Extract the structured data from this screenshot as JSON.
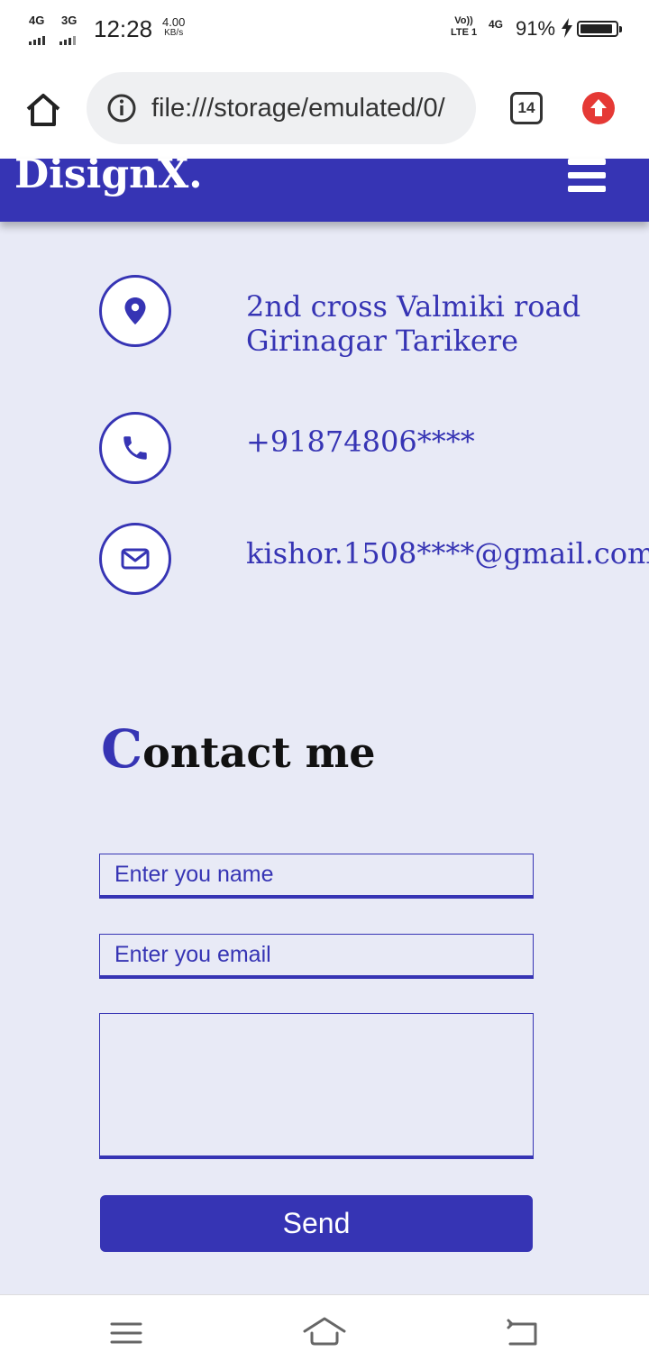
{
  "status_bar": {
    "net1": "4G",
    "net2": "3G",
    "time": "12:28",
    "speed_value": "4.00",
    "speed_unit": "KB/s",
    "volte_top": "Vo))",
    "volte_bottom": "LTE 1",
    "net3": "4G",
    "battery_percent": "91%",
    "battery_level": 0.91
  },
  "browser": {
    "url": "file:///storage/emulated/0/",
    "tab_count": "14",
    "icons": [
      "home-icon",
      "info-icon",
      "tabs-icon",
      "update-icon"
    ]
  },
  "site": {
    "logo": "DisignX.",
    "menu_icon": "hamburger-menu-icon",
    "accent_color": "#3634b4",
    "background_color": "#e8eaf6"
  },
  "contact_info": {
    "address_line1": "2nd cross Valmiki road",
    "address_line2": "Girinagar Tarikere",
    "phone": "+91874806****",
    "email": "kishor.1508****@gmail.com"
  },
  "contact_form": {
    "title_first_letter": "C",
    "title_rest": "ontact me",
    "name_placeholder": "Enter you name",
    "email_placeholder": "Enter you email",
    "message_placeholder": "",
    "send_label": "Send"
  },
  "nav_bar": {
    "icons": [
      "menu-icon",
      "home-icon",
      "back-icon"
    ]
  }
}
